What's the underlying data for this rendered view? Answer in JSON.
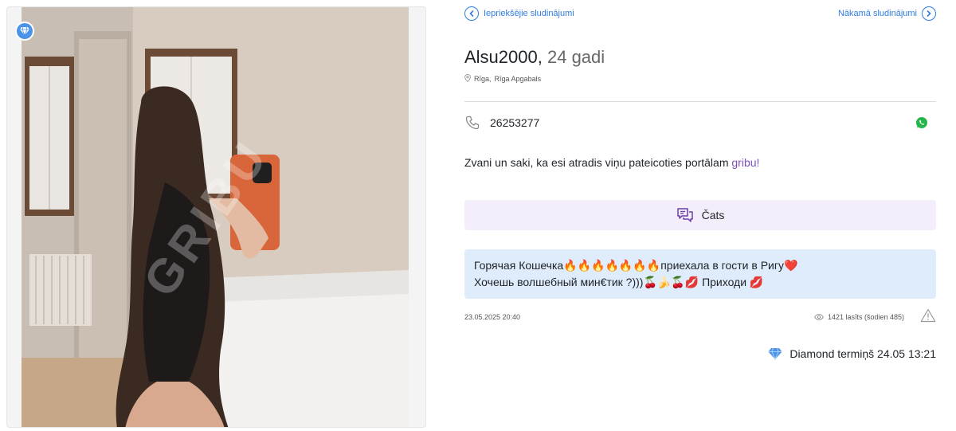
{
  "listing": {
    "name": "Alsu2000,",
    "age": "24 gadi",
    "location": {
      "city": "Rīga",
      "separator": ",",
      "region": "Rīga Apgabals"
    },
    "phone": "26253277",
    "call_hint": "Zvani un saki, ka esi atradis viņu pateicoties portālam",
    "call_hint_brand": "gribu!",
    "description_line1": "Горячая Кошечка🔥🔥🔥🔥🔥🔥🔥приехала в гости в Ригу❤️",
    "description_line2": "Хочешь волшебный мин€тик ?)))🍒🍌🍒💋 Приходи 💋",
    "posted_at": "23.05.2025 20:40",
    "views": "1421 lasīts (šodien 485)",
    "diamond_term": "Diamond termiņš 24.05 13:21"
  },
  "nav": {
    "prev_label": "Iepriekšējie sludinājumi",
    "next_label": "Nākamā sludinājumi"
  },
  "actions": {
    "chat_label": "Čats"
  },
  "photo": {
    "watermark": "GRIBU"
  },
  "icons": {
    "nav_prev": "chevron-left-icon",
    "nav_next": "chevron-right-icon",
    "location": "pin-icon",
    "phone": "phone-icon",
    "whatsapp": "whatsapp-icon",
    "chat": "chat-bubbles-icon",
    "views": "eye-icon",
    "report": "warning-triangle-icon",
    "diamond": "diamond-icon"
  },
  "colors": {
    "accent": "#2f7de1",
    "brand": "#7a4fbf",
    "chat_bg": "#f4eefb",
    "description_bg": "#dfecfb",
    "whatsapp": "#25b54a",
    "diamond": "#4b93e8"
  }
}
